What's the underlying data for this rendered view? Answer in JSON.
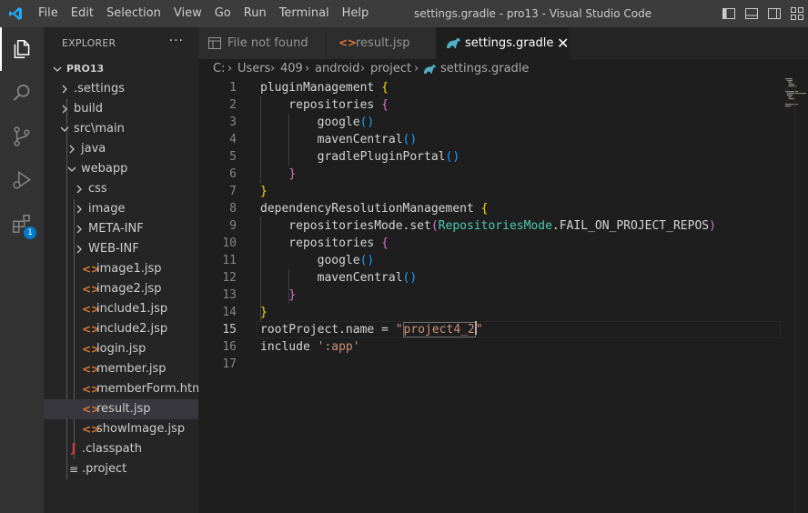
{
  "titlebar": {
    "menus": [
      "File",
      "Edit",
      "Selection",
      "View",
      "Go",
      "Run",
      "Terminal",
      "Help"
    ],
    "window_title": "settings.gradle - pro13 - Visual Studio Code",
    "layout_icons": [
      "toggle-primary-sidebar-icon",
      "toggle-panel-icon",
      "toggle-secondary-sidebar-icon",
      "customize-layout-icon"
    ]
  },
  "activitybar": {
    "items": [
      "explorer-icon",
      "search-icon",
      "source-control-icon",
      "run-debug-icon",
      "extensions-icon"
    ],
    "extensions_badge": "1"
  },
  "sidebar": {
    "title": "EXPLORER",
    "more": "···",
    "tree": [
      {
        "label": "PRO13",
        "icon": "",
        "chevron": "down"
      },
      {
        "label": ".settings",
        "icon": "",
        "chevron": "right"
      },
      {
        "label": "build",
        "icon": "",
        "chevron": "right"
      },
      {
        "label": "src\\main",
        "icon": "",
        "chevron": "down"
      },
      {
        "label": "java",
        "icon": "",
        "chevron": "right"
      },
      {
        "label": "webapp",
        "icon": "",
        "chevron": "down"
      },
      {
        "label": "css",
        "icon": "",
        "chevron": "right"
      },
      {
        "label": "image",
        "icon": "",
        "chevron": "right"
      },
      {
        "label": "META-INF",
        "icon": "",
        "chevron": "right"
      },
      {
        "label": "WEB-INF",
        "icon": "",
        "chevron": "right"
      },
      {
        "label": "image1.jsp",
        "icon": "<>",
        "chevron": ""
      },
      {
        "label": "image2.jsp",
        "icon": "<>",
        "chevron": ""
      },
      {
        "label": "include1.jsp",
        "icon": "<>",
        "chevron": ""
      },
      {
        "label": "include2.jsp",
        "icon": "<>",
        "chevron": ""
      },
      {
        "label": "login.jsp",
        "icon": "<>",
        "chevron": ""
      },
      {
        "label": "member.jsp",
        "icon": "<>",
        "chevron": ""
      },
      {
        "label": "memberForm.html",
        "icon": "<>",
        "chevron": ""
      },
      {
        "label": "result.jsp",
        "icon": "<>",
        "chevron": ""
      },
      {
        "label": "showImage.jsp",
        "icon": "<>",
        "chevron": ""
      },
      {
        "label": ".classpath",
        "icon": "J",
        "chevron": ""
      },
      {
        "label": ".project",
        "icon": "≡",
        "chevron": ""
      }
    ]
  },
  "tabs": [
    {
      "label": "File not found",
      "icon": "preview-icon"
    },
    {
      "label": "result.jsp",
      "icon": "html-icon"
    },
    {
      "label": "settings.gradle",
      "icon": "gradle-icon",
      "close": "✕"
    }
  ],
  "breadcrumb": [
    "C:",
    "Users",
    "409",
    "android",
    "project",
    "settings.gradle"
  ],
  "code": {
    "lines": [
      [
        {
          "t": "pluginManagement ",
          "c": "id"
        },
        {
          "t": "{",
          "c": "b1"
        }
      ],
      [
        {
          "t": "    repositories ",
          "c": "id"
        },
        {
          "t": "{",
          "c": "b2"
        }
      ],
      [
        {
          "t": "        google",
          "c": "id"
        },
        {
          "t": "()",
          "c": "b3"
        }
      ],
      [
        {
          "t": "        mavenCentral",
          "c": "id"
        },
        {
          "t": "()",
          "c": "b3"
        }
      ],
      [
        {
          "t": "        gradlePluginPortal",
          "c": "id"
        },
        {
          "t": "()",
          "c": "b3"
        }
      ],
      [
        {
          "t": "    ",
          "c": "id"
        },
        {
          "t": "}",
          "c": "b2"
        }
      ],
      [
        {
          "t": "}",
          "c": "b1"
        }
      ],
      [
        {
          "t": "dependencyResolutionManagement ",
          "c": "id"
        },
        {
          "t": "{",
          "c": "b1"
        }
      ],
      [
        {
          "t": "    repositoriesMode.set",
          "c": "id"
        },
        {
          "t": "(",
          "c": "b2"
        },
        {
          "t": "RepositoriesMode",
          "c": "cls"
        },
        {
          "t": ".FAIL_ON_PROJECT_REPOS",
          "c": "id"
        },
        {
          "t": ")",
          "c": "b2"
        }
      ],
      [
        {
          "t": "    repositories ",
          "c": "id"
        },
        {
          "t": "{",
          "c": "b2"
        }
      ],
      [
        {
          "t": "        google",
          "c": "id"
        },
        {
          "t": "()",
          "c": "b3"
        }
      ],
      [
        {
          "t": "        mavenCentral",
          "c": "id"
        },
        {
          "t": "()",
          "c": "b3"
        }
      ],
      [
        {
          "t": "    ",
          "c": "id"
        },
        {
          "t": "}",
          "c": "b2"
        }
      ],
      [
        {
          "t": "}",
          "c": "b1"
        }
      ],
      [
        {
          "t": "rootProject.name = ",
          "c": "id"
        },
        {
          "t": "\"",
          "c": "str"
        },
        {
          "t": "project4_2",
          "c": "str",
          "hl": true
        },
        {
          "t": "",
          "c": "caret"
        },
        {
          "t": "\"",
          "c": "str"
        }
      ],
      [
        {
          "t": "include ",
          "c": "id"
        },
        {
          "t": "':app'",
          "c": "str"
        }
      ],
      []
    ],
    "current_line": 15
  }
}
